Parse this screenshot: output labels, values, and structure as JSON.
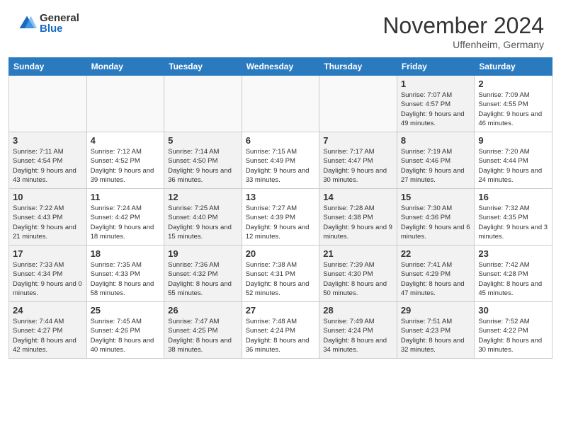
{
  "header": {
    "logo_general": "General",
    "logo_blue": "Blue",
    "month_title": "November 2024",
    "location": "Uffenheim, Germany"
  },
  "days_of_week": [
    "Sunday",
    "Monday",
    "Tuesday",
    "Wednesday",
    "Thursday",
    "Friday",
    "Saturday"
  ],
  "weeks": [
    [
      {
        "day": "",
        "info": "",
        "empty": true
      },
      {
        "day": "",
        "info": "",
        "empty": true
      },
      {
        "day": "",
        "info": "",
        "empty": true
      },
      {
        "day": "",
        "info": "",
        "empty": true
      },
      {
        "day": "",
        "info": "",
        "empty": true
      },
      {
        "day": "1",
        "info": "Sunrise: 7:07 AM\nSunset: 4:57 PM\nDaylight: 9 hours and 49 minutes.",
        "shaded": true
      },
      {
        "day": "2",
        "info": "Sunrise: 7:09 AM\nSunset: 4:55 PM\nDaylight: 9 hours and 46 minutes."
      }
    ],
    [
      {
        "day": "3",
        "info": "Sunrise: 7:11 AM\nSunset: 4:54 PM\nDaylight: 9 hours and 43 minutes.",
        "shaded": true
      },
      {
        "day": "4",
        "info": "Sunrise: 7:12 AM\nSunset: 4:52 PM\nDaylight: 9 hours and 39 minutes."
      },
      {
        "day": "5",
        "info": "Sunrise: 7:14 AM\nSunset: 4:50 PM\nDaylight: 9 hours and 36 minutes.",
        "shaded": true
      },
      {
        "day": "6",
        "info": "Sunrise: 7:15 AM\nSunset: 4:49 PM\nDaylight: 9 hours and 33 minutes."
      },
      {
        "day": "7",
        "info": "Sunrise: 7:17 AM\nSunset: 4:47 PM\nDaylight: 9 hours and 30 minutes.",
        "shaded": true
      },
      {
        "day": "8",
        "info": "Sunrise: 7:19 AM\nSunset: 4:46 PM\nDaylight: 9 hours and 27 minutes.",
        "shaded": true
      },
      {
        "day": "9",
        "info": "Sunrise: 7:20 AM\nSunset: 4:44 PM\nDaylight: 9 hours and 24 minutes."
      }
    ],
    [
      {
        "day": "10",
        "info": "Sunrise: 7:22 AM\nSunset: 4:43 PM\nDaylight: 9 hours and 21 minutes.",
        "shaded": true
      },
      {
        "day": "11",
        "info": "Sunrise: 7:24 AM\nSunset: 4:42 PM\nDaylight: 9 hours and 18 minutes."
      },
      {
        "day": "12",
        "info": "Sunrise: 7:25 AM\nSunset: 4:40 PM\nDaylight: 9 hours and 15 minutes.",
        "shaded": true
      },
      {
        "day": "13",
        "info": "Sunrise: 7:27 AM\nSunset: 4:39 PM\nDaylight: 9 hours and 12 minutes."
      },
      {
        "day": "14",
        "info": "Sunrise: 7:28 AM\nSunset: 4:38 PM\nDaylight: 9 hours and 9 minutes.",
        "shaded": true
      },
      {
        "day": "15",
        "info": "Sunrise: 7:30 AM\nSunset: 4:36 PM\nDaylight: 9 hours and 6 minutes.",
        "shaded": true
      },
      {
        "day": "16",
        "info": "Sunrise: 7:32 AM\nSunset: 4:35 PM\nDaylight: 9 hours and 3 minutes."
      }
    ],
    [
      {
        "day": "17",
        "info": "Sunrise: 7:33 AM\nSunset: 4:34 PM\nDaylight: 9 hours and 0 minutes.",
        "shaded": true
      },
      {
        "day": "18",
        "info": "Sunrise: 7:35 AM\nSunset: 4:33 PM\nDaylight: 8 hours and 58 minutes."
      },
      {
        "day": "19",
        "info": "Sunrise: 7:36 AM\nSunset: 4:32 PM\nDaylight: 8 hours and 55 minutes.",
        "shaded": true
      },
      {
        "day": "20",
        "info": "Sunrise: 7:38 AM\nSunset: 4:31 PM\nDaylight: 8 hours and 52 minutes."
      },
      {
        "day": "21",
        "info": "Sunrise: 7:39 AM\nSunset: 4:30 PM\nDaylight: 8 hours and 50 minutes.",
        "shaded": true
      },
      {
        "day": "22",
        "info": "Sunrise: 7:41 AM\nSunset: 4:29 PM\nDaylight: 8 hours and 47 minutes.",
        "shaded": true
      },
      {
        "day": "23",
        "info": "Sunrise: 7:42 AM\nSunset: 4:28 PM\nDaylight: 8 hours and 45 minutes."
      }
    ],
    [
      {
        "day": "24",
        "info": "Sunrise: 7:44 AM\nSunset: 4:27 PM\nDaylight: 8 hours and 42 minutes.",
        "shaded": true
      },
      {
        "day": "25",
        "info": "Sunrise: 7:45 AM\nSunset: 4:26 PM\nDaylight: 8 hours and 40 minutes."
      },
      {
        "day": "26",
        "info": "Sunrise: 7:47 AM\nSunset: 4:25 PM\nDaylight: 8 hours and 38 minutes.",
        "shaded": true
      },
      {
        "day": "27",
        "info": "Sunrise: 7:48 AM\nSunset: 4:24 PM\nDaylight: 8 hours and 36 minutes."
      },
      {
        "day": "28",
        "info": "Sunrise: 7:49 AM\nSunset: 4:24 PM\nDaylight: 8 hours and 34 minutes.",
        "shaded": true
      },
      {
        "day": "29",
        "info": "Sunrise: 7:51 AM\nSunset: 4:23 PM\nDaylight: 8 hours and 32 minutes.",
        "shaded": true
      },
      {
        "day": "30",
        "info": "Sunrise: 7:52 AM\nSunset: 4:22 PM\nDaylight: 8 hours and 30 minutes."
      }
    ]
  ]
}
